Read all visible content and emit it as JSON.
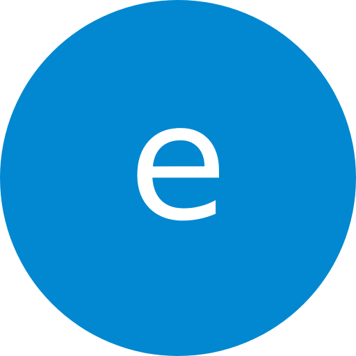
{
  "avatar": {
    "initial": "e",
    "background_color": "#0288D1",
    "text_color": "#FFFFFF"
  }
}
